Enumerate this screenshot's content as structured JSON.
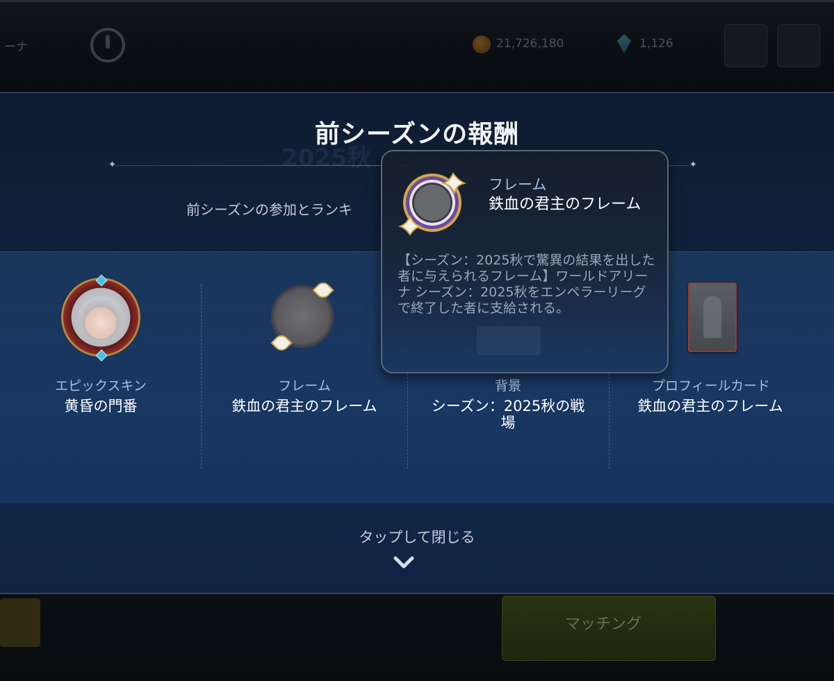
{
  "background": {
    "top_left_label": "ーナ",
    "gold_amount": "21,726,180",
    "gem_amount": "1,126",
    "match_button_label": "マッチング"
  },
  "modal": {
    "title": "前シーズンの報酬",
    "subtitle": "前シーズンの参加とランキ",
    "ghost_text": "2025秋",
    "close_hint": "タップして閉じる",
    "rewards": [
      {
        "type": "エピックスキン",
        "name": "黄昏の門番",
        "icon": "skin-portrait-icon"
      },
      {
        "type": "フレーム",
        "name": "鉄血の君主のフレーム",
        "icon": "frame-icon"
      },
      {
        "type": "背景",
        "name": "シーズン：2025秋の戦場",
        "icon": "background-icon"
      },
      {
        "type": "プロフィールカード",
        "name": "鉄血の君主のフレーム",
        "icon": "profile-card-icon"
      }
    ]
  },
  "tooltip": {
    "type": "フレーム",
    "name": "鉄血の君主のフレーム",
    "description": "【シーズン：2025秋で驚異の結果を出した者に与えられるフレーム】ワールドアリーナ シーズン：2025秋をエンペラーリーグで終了した者に支給される。",
    "icon": "frame-icon"
  },
  "colors": {
    "modal_bg": "#0f213a",
    "accent_text": "#9fc0e4",
    "frame_purple": "#7b5aa8",
    "frame_gold": "#cfa84a"
  }
}
